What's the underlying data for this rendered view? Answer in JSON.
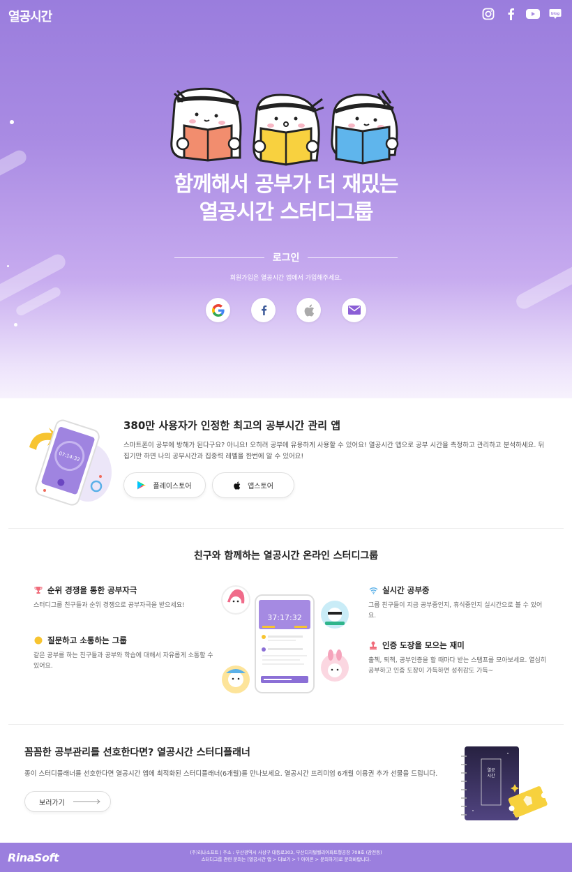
{
  "header": {
    "logo": "열공시간",
    "sns": [
      "instagram-icon",
      "facebook-icon",
      "youtube-icon",
      "blog-icon"
    ]
  },
  "hero": {
    "title_line1": "함께해서 공부가 더 재밌는",
    "title_line2": "열공시간 스터디그룹",
    "login_label": "로그인",
    "login_sub": "회원가입은 열공시간 앱에서 가입해주세요.",
    "login_buttons": [
      "google-icon",
      "facebook-icon",
      "apple-icon",
      "mail-icon"
    ]
  },
  "app": {
    "title": "380만 사용자가 인정한 최고의 공부시간 관리 앱",
    "desc": "스마트폰이 공부에 방해가 된다구요? 아니요! 오히려 공부에 유용하게 사용할 수 있어요! 열공시간 앱으로 공부 시간을 측정하고 관리하고 분석하세요. 뒤집기만 하면 나의 공부시간과 집중력 레벨을 한번에 알 수 있어요!",
    "phone_time": "07:14:32",
    "play_store": "플레이스토어",
    "app_store": "앱스토어"
  },
  "group": {
    "title": "친구와 함께하는 열공시간 온라인 스터디그룹",
    "phone_time": "37:17:32",
    "features": [
      {
        "title": "순위 경쟁을 통한 공부자극",
        "desc": "스터디그룹 친구들과 순위 경쟁으로 공부자극을 받으세요!"
      },
      {
        "title": "질문하고 소통하는 그룹",
        "desc": "같은 공부를 하는 친구들과 공부와 학습에 대해서 자유롭게 소통할 수 있어요."
      },
      {
        "title": "실시간 공부중",
        "desc": "그룹 친구들이 지금 공부중인지, 휴식중인지 실시간으로 볼 수 있어요."
      },
      {
        "title": "인증 도장을 모으는 재미",
        "desc": "출첵, 퇴첵, 공부인증을 할 때마다 받는 스탬프를 모아보세요. 열심히 공부하고 인증 도장이 가득하면 성취감도 가득~"
      }
    ]
  },
  "planner": {
    "title": "꼼꼼한 공부관리를 선호한다면? 열공시간 스터디플래너",
    "desc": "종이 스터디플래너를 선호한다면 열공시간 앱에 최적화된 스터디플래너(6개월)를 만나보세요. 열공시간 프리미엄 6개월 이용권 추가 선물을 드립니다.",
    "button": "보러가기",
    "book_label_1": "열공",
    "book_label_2": "시간"
  },
  "footer": {
    "logo": "RinaSoft",
    "info_line1": "(주)리나소프트 | 주소 : 부산광역시 사상구 대동로303, 부산디지털벨리아파트형공장 708호 (감전동)",
    "info_line2": "스터디그룹 관련 문의는 [열공시간 앱 > 더보기 > ? 아이콘 > 문의하기]로 문의바랍니다."
  },
  "colors": {
    "brand_purple": "#9b7fde",
    "kakao_yellow": "#f7d13d"
  }
}
